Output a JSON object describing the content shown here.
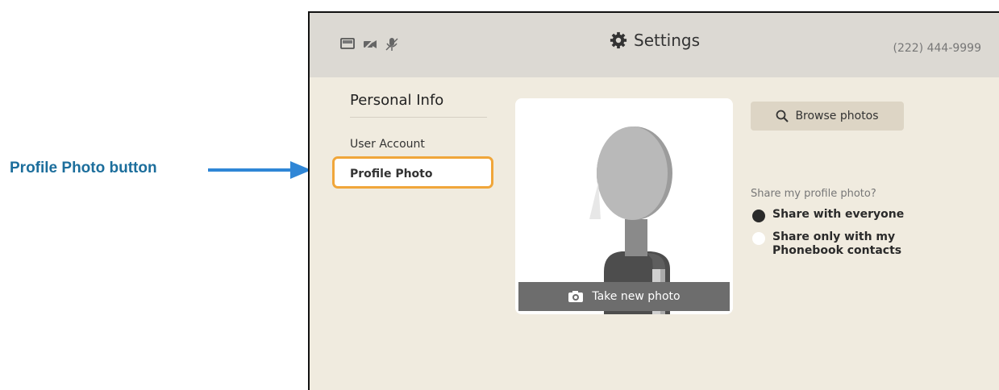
{
  "callout": {
    "label": "Profile Photo button"
  },
  "header": {
    "title": "Settings",
    "phone": "(222) 444-9999",
    "status_icons": [
      "video-status-icon",
      "camera-off-icon",
      "mic-off-icon"
    ]
  },
  "sidebar": {
    "heading": "Personal Info",
    "items": [
      {
        "label": "User Account"
      },
      {
        "label": "Profile Photo",
        "selected": true
      }
    ]
  },
  "photo": {
    "take_new_label": "Take new photo"
  },
  "browse": {
    "label": "Browse photos"
  },
  "share": {
    "question": "Share my profile photo?",
    "options": [
      {
        "label": "Share with everyone",
        "selected": true
      },
      {
        "label_line1": "Share only with my",
        "label_line2": "Phonebook contacts",
        "selected": false
      }
    ]
  },
  "colors": {
    "accent_highlight": "#f0a63a",
    "callout_blue": "#1c6e9c",
    "screen_bg": "#f0ebdf"
  }
}
